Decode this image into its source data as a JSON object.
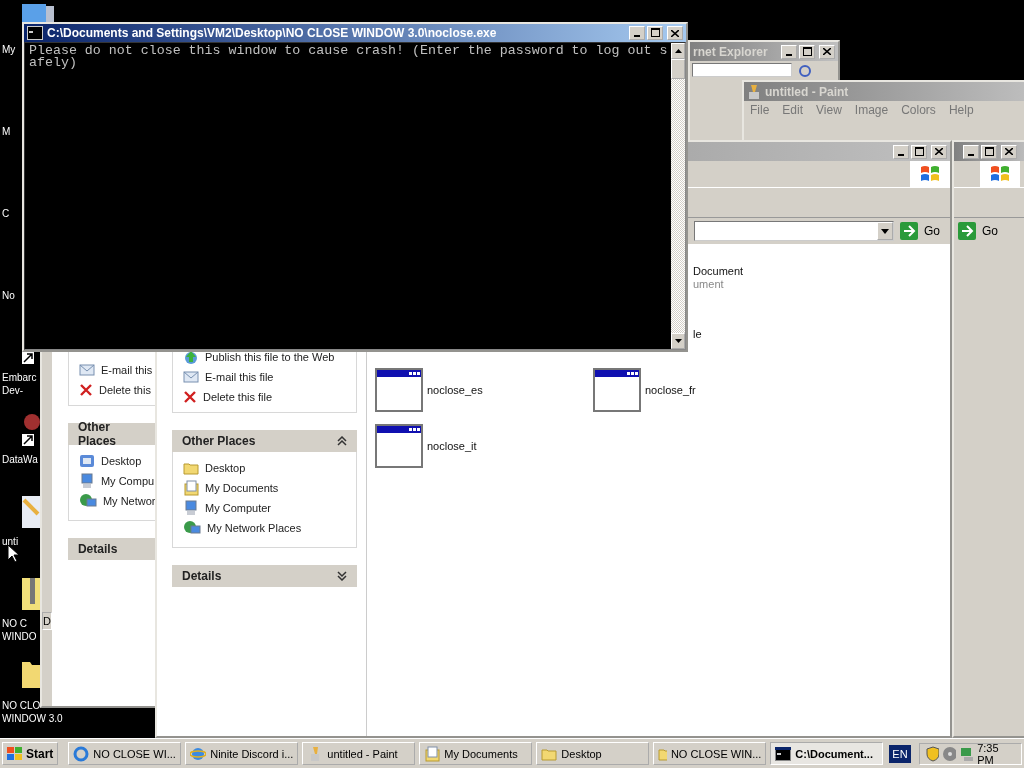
{
  "desktop_icons": [
    {
      "kind": "computer",
      "lines": [
        "My"
      ]
    },
    {
      "lines": [
        "M"
      ]
    },
    {
      "lines": [
        "C"
      ]
    },
    {
      "lines": [
        "No"
      ]
    },
    {
      "kind": "shortcut",
      "lines": [
        "Embarc",
        "Dev-"
      ]
    },
    {
      "kind": "shortcut",
      "lines": [
        "DataWa"
      ]
    },
    {
      "kind": "paint",
      "lines": [
        "unti"
      ]
    },
    {
      "kind": "zip",
      "lines": [
        "NO C",
        "WINDO"
      ]
    },
    {
      "kind": "folder",
      "lines": [
        "NO CLO",
        "WINDOW 3.0"
      ]
    }
  ],
  "back_explorer": {
    "status_text": "D",
    "tasks": [
      {
        "kind": "email",
        "label": "E-mail this"
      },
      {
        "kind": "delete",
        "label": "Delete this"
      }
    ],
    "other_places": {
      "title": "Other Places",
      "items": [
        {
          "kind": "desktop",
          "label": "Desktop"
        },
        {
          "kind": "computer",
          "label": "My Compu"
        },
        {
          "kind": "network",
          "label": "My Networ"
        }
      ]
    },
    "details": {
      "title": "Details"
    }
  },
  "internet_explorer": {
    "title": "rnet Explorer",
    "active": false
  },
  "paint": {
    "title": "untitled - Paint",
    "active": false,
    "menu": [
      "File",
      "Edit",
      "View",
      "Image",
      "Colors",
      "Help"
    ]
  },
  "explorer": {
    "active": false,
    "go_label": "Go",
    "tasks": [
      {
        "kind": "publish",
        "label": "Publish this file to the Web"
      },
      {
        "kind": "email",
        "label": "E-mail this file"
      },
      {
        "kind": "delete",
        "label": "Delete this file"
      }
    ],
    "other_places": {
      "title": "Other Places",
      "expanded": true,
      "items": [
        {
          "kind": "folder",
          "label": "Desktop"
        },
        {
          "kind": "documents",
          "label": "My Documents"
        },
        {
          "kind": "computer",
          "label": "My Computer"
        },
        {
          "kind": "network",
          "label": "My Network Places"
        }
      ]
    },
    "details": {
      "title": "Details",
      "expanded": false
    },
    "files": [
      {
        "kind": "partial",
        "lines": [
          "Document",
          "ument"
        ]
      },
      {
        "kind": "partial",
        "lines": [
          "le"
        ]
      },
      {
        "kind": "app",
        "lines": [
          "noclose_es"
        ]
      },
      {
        "kind": "app",
        "lines": [
          "noclose_fr"
        ]
      },
      {
        "kind": "app",
        "lines": [
          "noclose_it"
        ]
      }
    ]
  },
  "right_explorer": {
    "active": false,
    "go_label": "Go"
  },
  "console": {
    "title": "C:\\Documents and Settings\\VM2\\Desktop\\NO CLOSE WINDOW 3.0\\noclose.exe",
    "active": true,
    "output": "Please do not close this window to cause crash! (Enter the password to log out safely)"
  },
  "taskbar": {
    "start_label": "Start",
    "buttons": [
      {
        "kind": "chrome",
        "label": "NO CLOSE WI...",
        "selected": false
      },
      {
        "kind": "ie",
        "label": "Ninite Discord i...",
        "selected": false
      },
      {
        "kind": "paint",
        "label": "untitled - Paint",
        "selected": false
      },
      {
        "kind": "documents",
        "label": "My Documents",
        "selected": false
      },
      {
        "kind": "folder",
        "label": "Desktop",
        "selected": false
      },
      {
        "kind": "folder",
        "label": "NO CLOSE WIN...",
        "selected": false
      },
      {
        "kind": "console",
        "label": "C:\\Document...",
        "selected": true
      }
    ],
    "language": "EN",
    "clock": "7:35 PM"
  }
}
